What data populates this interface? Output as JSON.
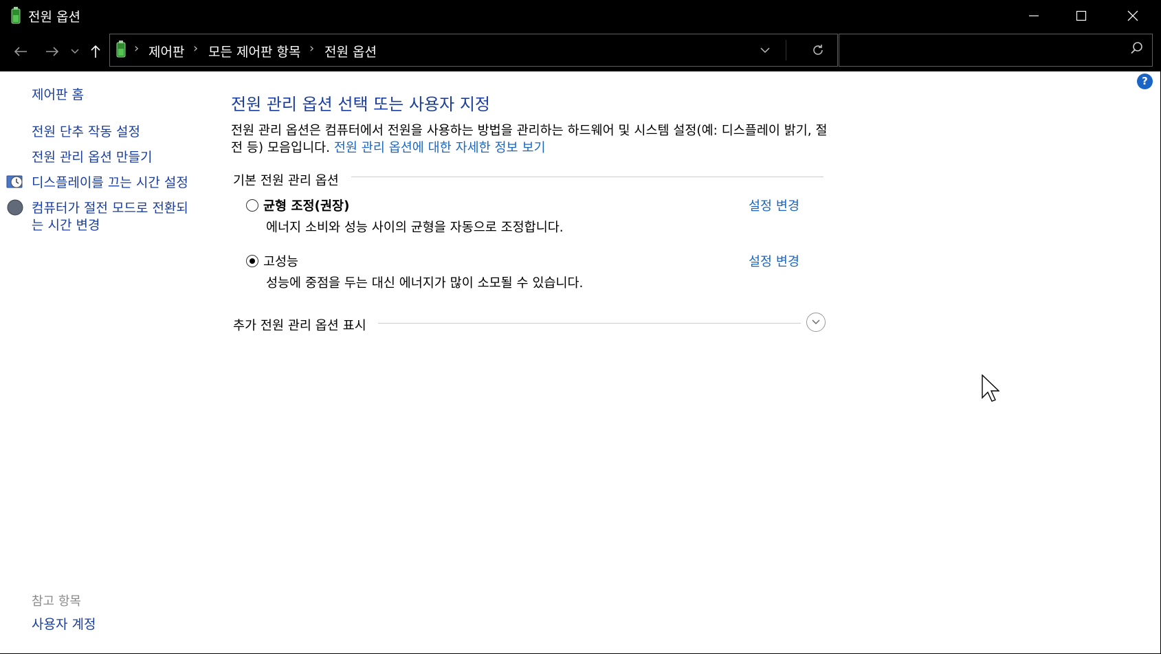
{
  "window": {
    "title": "전원 옵션",
    "minimize_glyph": "—",
    "maximize_glyph": "☐",
    "close_glyph": "✕"
  },
  "nav": {
    "back_icon": "back-arrow-icon",
    "forward_icon": "forward-arrow-icon",
    "recent_icon": "chevron-down-icon",
    "up_icon": "up-arrow-icon",
    "breadcrumbs": [
      "제어판",
      "모든 제어판 항목",
      "전원 옵션"
    ],
    "search_placeholder": ""
  },
  "sidebar": {
    "home": "제어판 홈",
    "links": [
      {
        "label": "전원 단추 작동 설정",
        "icon": null
      },
      {
        "label": "전원 관리 옵션 만들기",
        "icon": null
      },
      {
        "label": "디스플레이를 끄는 시간 설정",
        "icon": "display-clock-icon"
      },
      {
        "label": "컴퓨터가 절전 모드로 전환되\n는 시간 변경",
        "icon": "moon-sleep-icon"
      }
    ],
    "see_also_title": "참고 항목",
    "see_also_links": [
      "사용자 계정"
    ]
  },
  "main": {
    "heading": "전원 관리 옵션 선택 또는 사용자 지정",
    "description": "전원 관리 옵션은 컴퓨터에서 전원을 사용하는 방법을 관리하는 하드웨어 및 시스템 설정(예: 디스플레이 밝기, 절전 등) 모음입니다.",
    "description_link": "전원 관리 옵션에 대한 자세한 정보 보기",
    "group_title": "기본 전원 관리 옵션",
    "plans": [
      {
        "name": "균형 조정(권장)",
        "bold": true,
        "selected": false,
        "description": "에너지 소비와 성능 사이의 균형을 자동으로 조정합니다.",
        "link": "설정 변경"
      },
      {
        "name": "고성능",
        "bold": false,
        "selected": true,
        "description": "성능에 중점을 두는 대신 에너지가 많이 소모될 수 있습니다.",
        "link": "설정 변경"
      }
    ],
    "extra_title": "추가 전원 관리 옵션 표시"
  },
  "help_label": "?",
  "colors": {
    "link": "#1a66c4",
    "heading": "#1a3e9f",
    "help": "#1a64c8"
  }
}
